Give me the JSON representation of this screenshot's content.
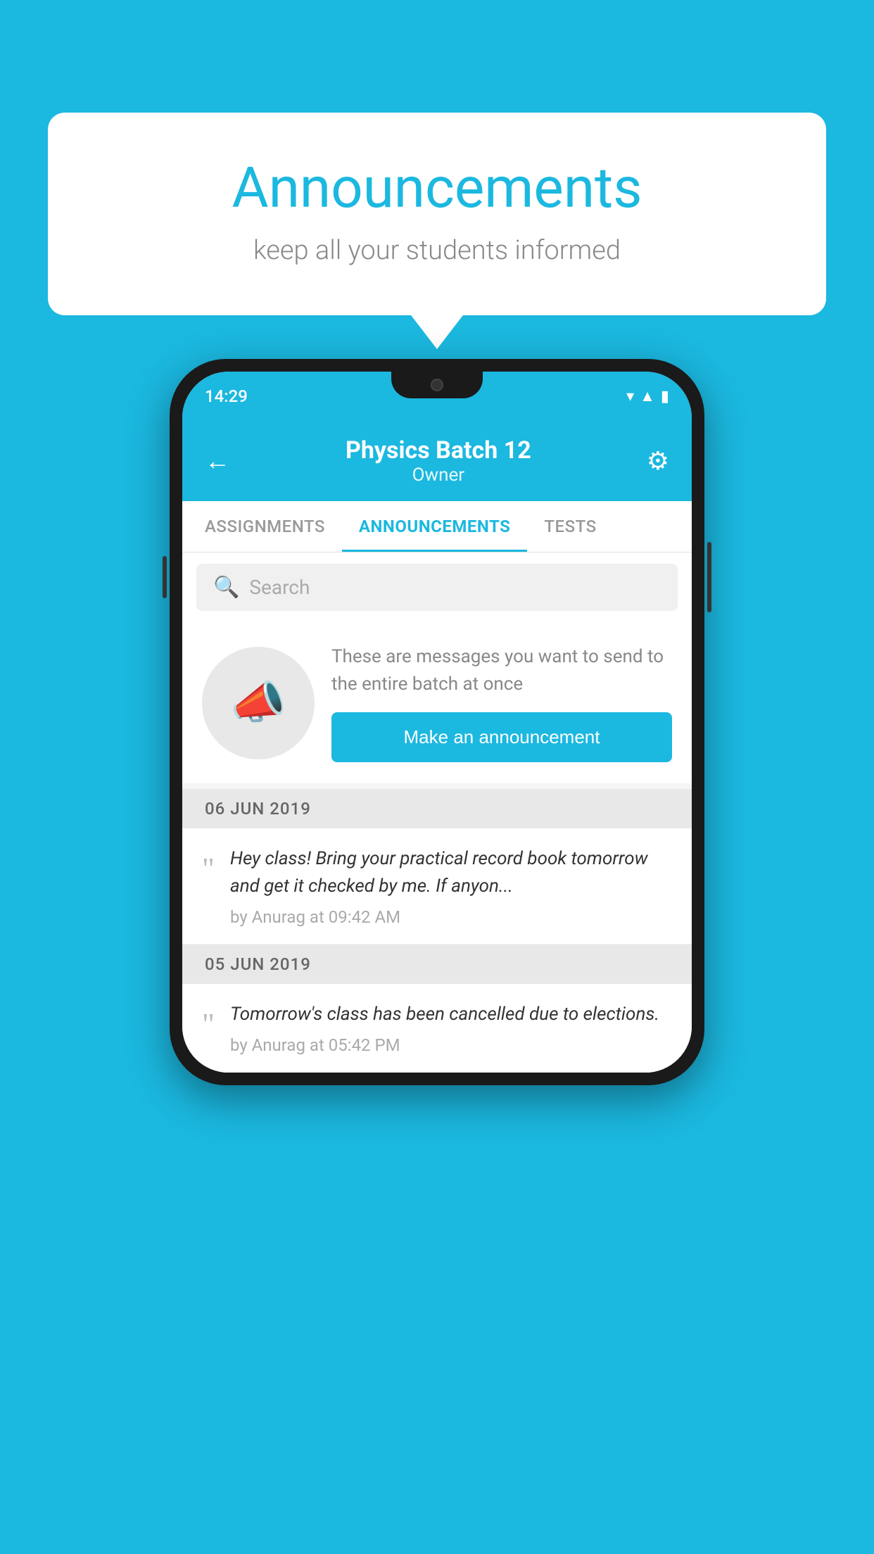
{
  "background_color": "#1bb8e0",
  "speech_bubble": {
    "title": "Announcements",
    "subtitle": "keep all your students informed"
  },
  "phone": {
    "status_bar": {
      "time": "14:29"
    },
    "header": {
      "title": "Physics Batch 12",
      "subtitle": "Owner",
      "back_label": "←",
      "gear_label": "⚙"
    },
    "tabs": [
      {
        "label": "ASSIGNMENTS",
        "active": false
      },
      {
        "label": "ANNOUNCEMENTS",
        "active": true
      },
      {
        "label": "TESTS",
        "active": false
      }
    ],
    "search": {
      "placeholder": "Search"
    },
    "promo": {
      "description": "These are messages you want to send to the entire batch at once",
      "button_label": "Make an announcement"
    },
    "announcements": [
      {
        "date": "06  JUN  2019",
        "text": "Hey class! Bring your practical record book tomorrow and get it checked by me. If anyon...",
        "meta": "by Anurag at 09:42 AM"
      },
      {
        "date": "05  JUN  2019",
        "text": "Tomorrow's class has been cancelled due to elections.",
        "meta": "by Anurag at 05:42 PM"
      }
    ]
  }
}
